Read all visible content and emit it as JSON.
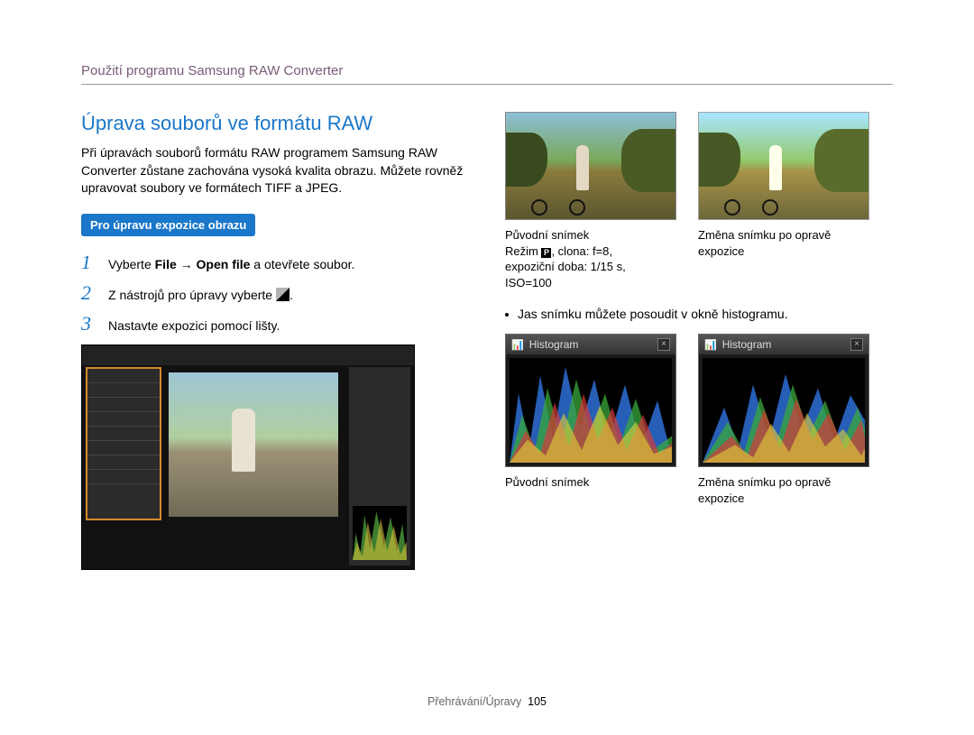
{
  "header": "Použití programu Samsung RAW Converter",
  "section_title": "Úprava souborů ve formátu RAW",
  "intro": "Při úpravách souborů formátu RAW programem Samsung RAW Converter zůstane zachována vysoká kvalita obrazu. Můžete rovněž upravovat soubory ve formátech TIFF a JPEG.",
  "badge": "Pro úpravu expozice obrazu",
  "steps": [
    {
      "pre": "Vyberte ",
      "bold": "File → Open file",
      "post": " a otevřete soubor."
    },
    {
      "pre": "Z nástrojů pro úpravy vyberte ",
      "bold": "",
      "post": "."
    },
    {
      "pre": "Nastavte expozici pomocí lišty.",
      "bold": "",
      "post": ""
    }
  ],
  "right": {
    "cap1_line1": "Původní snímek",
    "cap1_line2a": "Režim ",
    "cap1_line2b": ", clona: f=8,",
    "cap1_line3": "expoziční doba: 1/15 s,",
    "cap1_line4": "ISO=100",
    "cap2_line1": "Změna snímku po opravě",
    "cap2_line2": "expozice",
    "bullet": "Jas snímku můžete posoudit v okně histogramu.",
    "hist_title": "Histogram",
    "hcap1": "Původní snímek",
    "hcap2_line1": "Změna snímku po opravě",
    "hcap2_line2": "expozice"
  },
  "footer": {
    "section": "Přehrávání/Úpravy",
    "page": "105"
  }
}
